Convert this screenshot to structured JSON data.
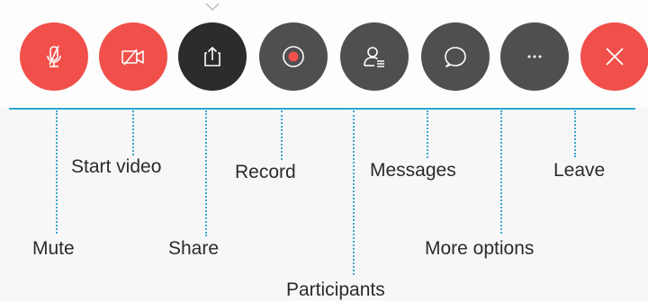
{
  "colors": {
    "red": "#f1504a",
    "dark": "#2c2c2c",
    "gray": "#4f4f51",
    "accent": "#2aa8d4",
    "leader": "#3aa6d0"
  },
  "toolbar": {
    "buttons": [
      {
        "id": "mute",
        "icon": "microphone-muted-icon"
      },
      {
        "id": "start-video",
        "icon": "video-camera-off-icon"
      },
      {
        "id": "share",
        "icon": "share-upload-icon"
      },
      {
        "id": "record",
        "icon": "record-icon"
      },
      {
        "id": "participants",
        "icon": "participants-icon"
      },
      {
        "id": "messages",
        "icon": "chat-bubble-icon"
      },
      {
        "id": "more-options",
        "icon": "ellipsis-icon"
      },
      {
        "id": "leave",
        "icon": "close-icon"
      }
    ]
  },
  "labels": {
    "mute": "Mute",
    "start_video": "Start video",
    "share": "Share",
    "record": "Record",
    "participants": "Participants",
    "messages": "Messages",
    "more_options": "More options",
    "leave": "Leave"
  }
}
